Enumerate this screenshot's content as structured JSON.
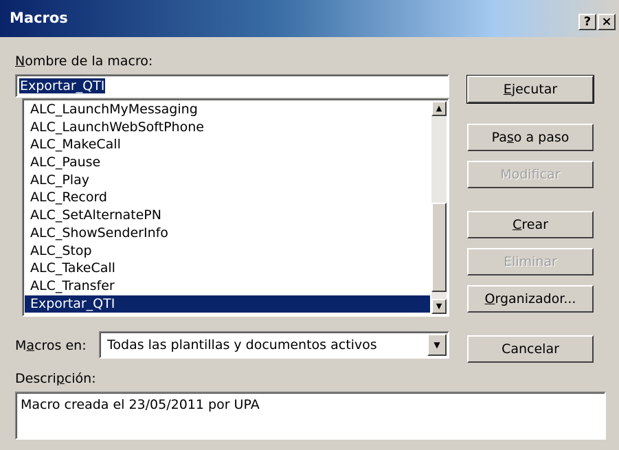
{
  "window": {
    "title": "Macros",
    "help_label": "?",
    "close_label": "×"
  },
  "macro_name": {
    "label_key": "N",
    "label_rest": "ombre de la macro:",
    "value": "Exportar_QTI"
  },
  "macro_list": {
    "items": [
      "ALC_LaunchMyMessaging",
      "ALC_LaunchWebSoftPhone",
      "ALC_MakeCall",
      "ALC_Pause",
      "ALC_Play",
      "ALC_Record",
      "ALC_SetAlternatePN",
      "ALC_ShowSenderInfo",
      "ALC_Stop",
      "ALC_TakeCall",
      "ALC_Transfer",
      "Exportar_QTI"
    ],
    "selected": "Exportar_QTI"
  },
  "buttons": {
    "run": {
      "key": "E",
      "rest": "jecutar"
    },
    "step": {
      "pre": "Pa",
      "key": "s",
      "rest": "o a paso"
    },
    "edit": {
      "label": "Modificar",
      "disabled": true
    },
    "create": {
      "key": "C",
      "rest": "rear"
    },
    "delete": {
      "label": "Eliminar",
      "disabled": true
    },
    "organizer": {
      "key": "O",
      "rest": "rganizador..."
    },
    "cancel": {
      "label": "Cancelar"
    }
  },
  "macros_in": {
    "pre": "M",
    "key": "a",
    "rest": "cros en:",
    "value": "Todas las plantillas y documentos activos"
  },
  "description": {
    "pre": "Descri",
    "key": "p",
    "rest": "ción:",
    "value": "Macro creada el 23/05/2011 por UPA"
  },
  "icons": {
    "scroll_up": "scroll-up-arrow-icon",
    "scroll_down": "scroll-down-arrow-icon",
    "dropdown": "dropdown-arrow-icon"
  }
}
